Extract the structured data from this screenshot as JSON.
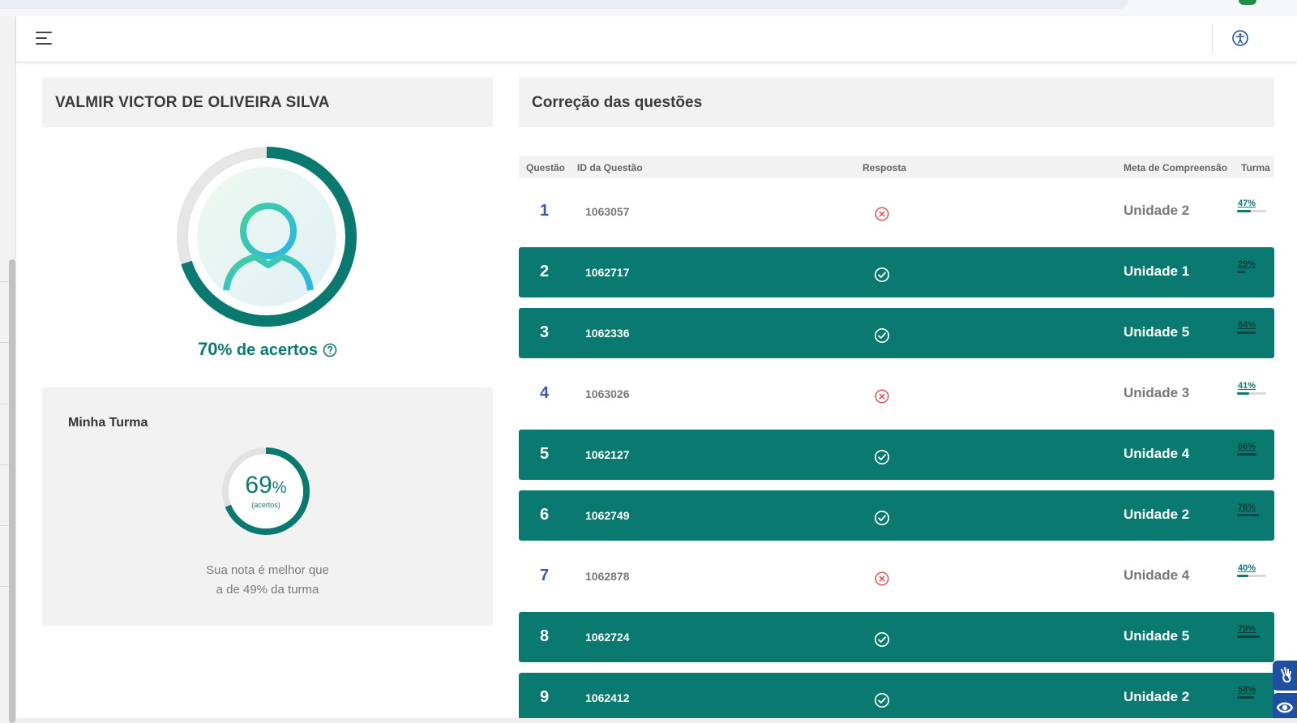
{
  "header": {
    "menu_icon": "hamburger-menu-icon",
    "accessibility_icon": "accessibility-person-icon"
  },
  "student": {
    "name": "VALMIR VICTOR DE OLIVEIRA SILVA",
    "avatar_icon": "user-avatar-icon",
    "score_percent": 70,
    "score_number": "70",
    "score_text": "% de acertos",
    "help_icon": "question-circle-icon"
  },
  "class": {
    "title": "Minha Turma",
    "percent_value": 69,
    "percent_number": "69",
    "percent_sign": "%",
    "percent_sub": "(acertos)",
    "compare_line1": "Sua nota é melhor que",
    "compare_line2": "a de 49% da turma"
  },
  "corrections": {
    "title": "Correção das questões",
    "headers": {
      "question": "Questão",
      "id": "ID da Questão",
      "answer": "Resposta",
      "meta": "Meta de Compreensão",
      "turma": "Turma"
    },
    "rows": [
      {
        "q": "1",
        "id": "1063057",
        "correct": false,
        "meta": "Unidade 2",
        "turma": "47%",
        "turma_value": 47
      },
      {
        "q": "2",
        "id": "1062717",
        "correct": true,
        "meta": "Unidade 1",
        "turma": "29%",
        "turma_value": 29
      },
      {
        "q": "3",
        "id": "1062336",
        "correct": true,
        "meta": "Unidade 5",
        "turma": "64%",
        "turma_value": 64
      },
      {
        "q": "4",
        "id": "1063026",
        "correct": false,
        "meta": "Unidade 3",
        "turma": "41%",
        "turma_value": 41
      },
      {
        "q": "5",
        "id": "1062127",
        "correct": true,
        "meta": "Unidade 4",
        "turma": "66%",
        "turma_value": 66
      },
      {
        "q": "6",
        "id": "1062749",
        "correct": true,
        "meta": "Unidade 2",
        "turma": "76%",
        "turma_value": 76
      },
      {
        "q": "7",
        "id": "1062878",
        "correct": false,
        "meta": "Unidade 4",
        "turma": "40%",
        "turma_value": 40
      },
      {
        "q": "8",
        "id": "1062724",
        "correct": true,
        "meta": "Unidade 5",
        "turma": "79%",
        "turma_value": 79
      },
      {
        "q": "9",
        "id": "1062412",
        "correct": true,
        "meta": "Unidade 2",
        "turma": "58%",
        "turma_value": 58
      }
    ]
  },
  "colors": {
    "primary": "#0a7a70",
    "wrong": "#d9534f",
    "question_number": "#3a55b5",
    "card_bg": "#f2f2f2"
  },
  "widgets": {
    "sign_language_icon": "sign-language-hands-icon",
    "eye_icon": "eye-icon"
  }
}
